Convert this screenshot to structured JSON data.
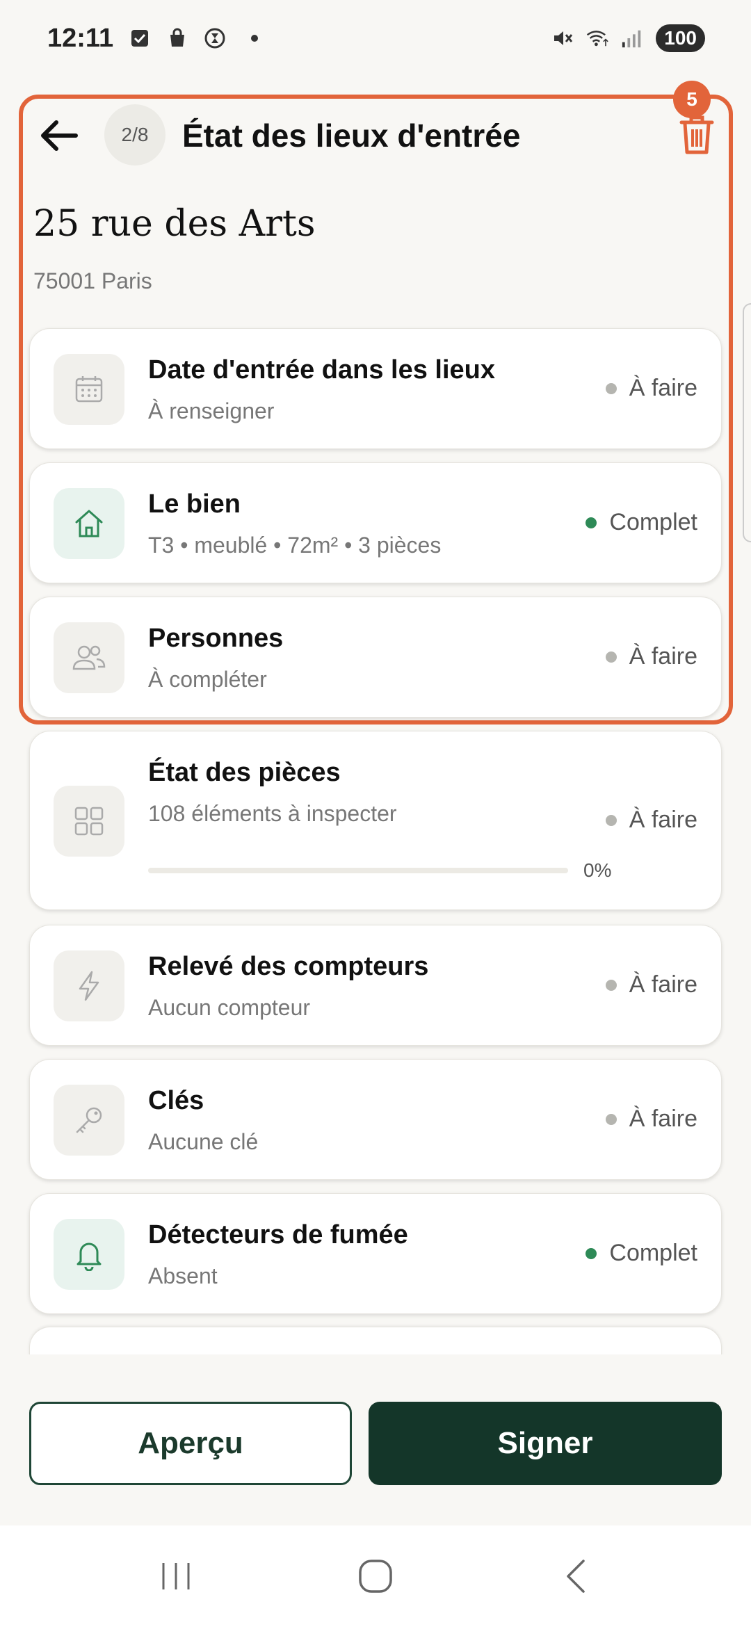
{
  "status_bar": {
    "time": "12:11",
    "battery": "100",
    "icons": [
      "checkbox-icon",
      "shopping-bag-icon",
      "hourglass-icon",
      "mute-icon",
      "wifi-icon",
      "signal-icon"
    ]
  },
  "header": {
    "step": "2/8",
    "title": "État des lieux d'entrée",
    "notification_count": "5"
  },
  "address": {
    "street": "25 rue des Arts",
    "city": "75001 Paris"
  },
  "sections": [
    {
      "title": "Date d'entrée dans les lieux",
      "subtitle": "À renseigner",
      "status": "À faire",
      "complete": false,
      "icon": "calendar-icon"
    },
    {
      "title": "Le bien",
      "subtitle": "T3 • meublé • 72m² • 3 pièces",
      "status": "Complet",
      "complete": true,
      "icon": "house-icon"
    },
    {
      "title": "Personnes",
      "subtitle": "À compléter",
      "status": "À faire",
      "complete": false,
      "icon": "people-icon"
    },
    {
      "title": "État des pièces",
      "subtitle": "108 éléments à inspecter",
      "status": "À faire",
      "complete": false,
      "icon": "grid-icon",
      "progress": 0,
      "progress_label": "0%"
    },
    {
      "title": "Relevé des compteurs",
      "subtitle": "Aucun compteur",
      "status": "À faire",
      "complete": false,
      "icon": "lightning-icon"
    },
    {
      "title": "Clés",
      "subtitle": "Aucune clé",
      "status": "À faire",
      "complete": false,
      "icon": "key-icon"
    },
    {
      "title": "Détecteurs de fumée",
      "subtitle": "Absent",
      "status": "Complet",
      "complete": true,
      "icon": "bell-icon"
    }
  ],
  "actions": {
    "preview_label": "Aperçu",
    "sign_label": "Signer"
  },
  "colors": {
    "accent_orange": "#e2643a",
    "dark_green": "#143629",
    "status_green": "#2e8a57",
    "status_grey": "#b5b5b0"
  }
}
